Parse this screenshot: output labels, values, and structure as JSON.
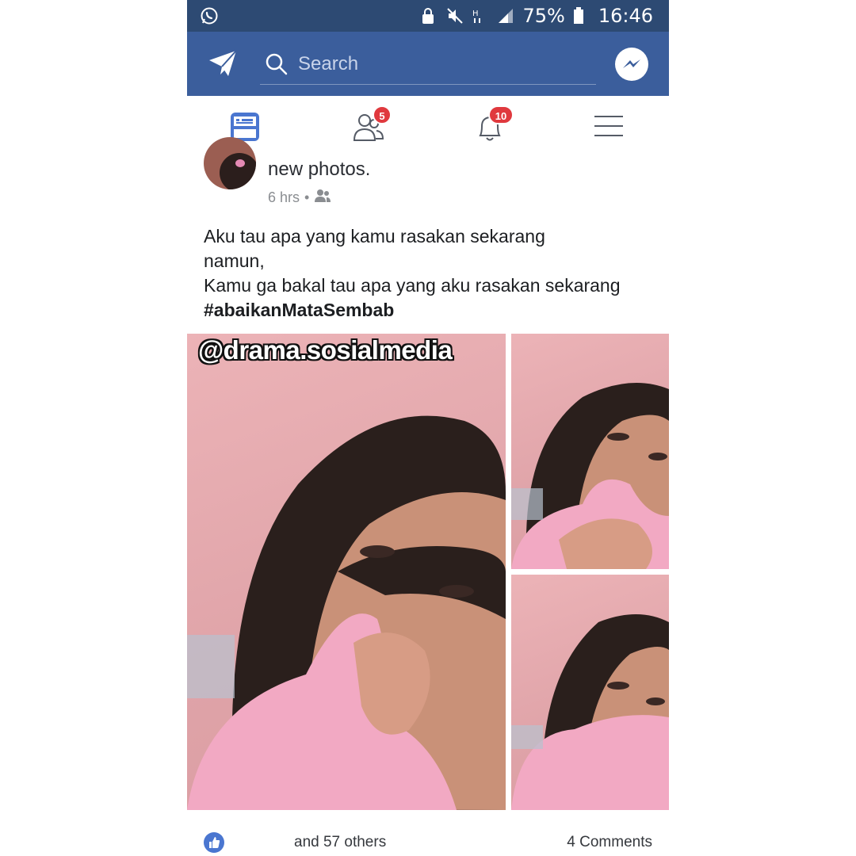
{
  "status_bar": {
    "battery": "75%",
    "time": "16:46"
  },
  "header": {
    "search": {
      "placeholder": "Search"
    }
  },
  "tabs": {
    "friend_requests_count": "5",
    "notifications_count": "10"
  },
  "post": {
    "action_text": "new photos.",
    "time": "6 hrs",
    "meta_separator": "•",
    "body_lines": [
      "Aku tau apa yang kamu rasakan sekarang",
      "namun,",
      "Kamu ga bakal tau apa yang aku rasakan sekarang"
    ],
    "hashtag": "#abaikanMataSembab",
    "watermark": "@drama.sosialmedia",
    "reactions_text": "and 57 others",
    "comments_text": "4 Comments"
  },
  "colors": {
    "status_bar": "#2d4a73",
    "header": "#3b5e9c",
    "badge": "#e0393e",
    "active_tab": "#4a76d0",
    "photo_pink": "#e9aeb3"
  },
  "icons": {
    "status_left": "whatsapp-icon",
    "header_left": "paper-plane-icon",
    "header_right": "messenger-icon",
    "tab_feed": "news-feed-icon",
    "tab_friends": "friends-icon",
    "tab_notifications": "bell-icon",
    "tab_menu": "hamburger-menu-icon"
  }
}
